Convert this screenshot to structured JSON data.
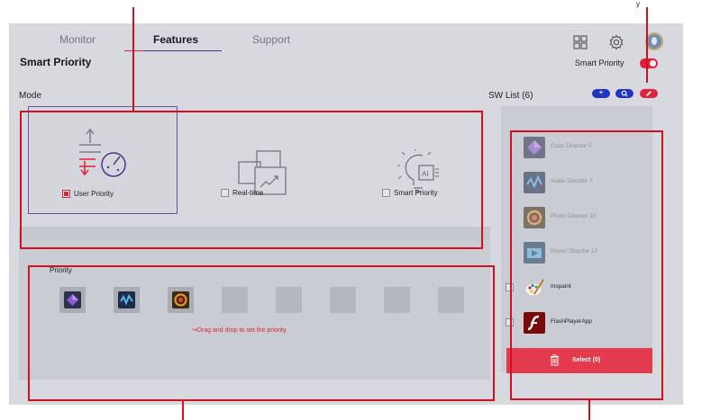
{
  "tabs": [
    {
      "label": "Monitor",
      "active": false
    },
    {
      "label": "Features",
      "active": true
    },
    {
      "label": "Support",
      "active": false
    }
  ],
  "header": {
    "icons": [
      "grid-icon",
      "gear-icon",
      "avatar"
    ]
  },
  "page": {
    "title": "Smart Priority",
    "toggle_label": "Smart Priority",
    "toggle_on": true
  },
  "mode": {
    "label": "Mode",
    "options": [
      {
        "label": "User Priority",
        "checked": true,
        "icon": "user-priority-gauge-icon"
      },
      {
        "label": "Real-time",
        "checked": false,
        "icon": "realtime-windows-icon"
      },
      {
        "label": "Smart Priority",
        "checked": false,
        "icon": "ai-bulb-icon"
      }
    ]
  },
  "priority": {
    "label": "Priority",
    "hint": "Drag and drop to set the priority.",
    "slots": [
      "Color Director 5",
      "Audio Director 7",
      "Photo Director 10",
      "",
      "",
      "",
      "",
      ""
    ]
  },
  "sw_list": {
    "label": "SW List (6)",
    "actions": [
      "add-icon",
      "search-icon",
      "edit-icon"
    ],
    "items": [
      {
        "name": "Color Director 5",
        "enabled": false,
        "icon": "color-director-icon"
      },
      {
        "name": "Audio Director 7",
        "enabled": false,
        "icon": "audio-director-icon"
      },
      {
        "name": "Photo Director 10",
        "enabled": false,
        "icon": "photo-director-icon"
      },
      {
        "name": "Power Director 17",
        "enabled": false,
        "icon": "power-director-icon"
      },
      {
        "name": "mspaint",
        "enabled": true,
        "icon": "paint-palette-icon"
      },
      {
        "name": "FlashPlayerApp",
        "enabled": true,
        "icon": "flash-player-icon"
      }
    ],
    "select_label": "Select (0)"
  },
  "callout_caption": "y",
  "colors": {
    "accent": "#e0213b",
    "panel": "#d7d9de",
    "selected_border": "#5b57a9",
    "pill_blue": "#2234c4"
  }
}
